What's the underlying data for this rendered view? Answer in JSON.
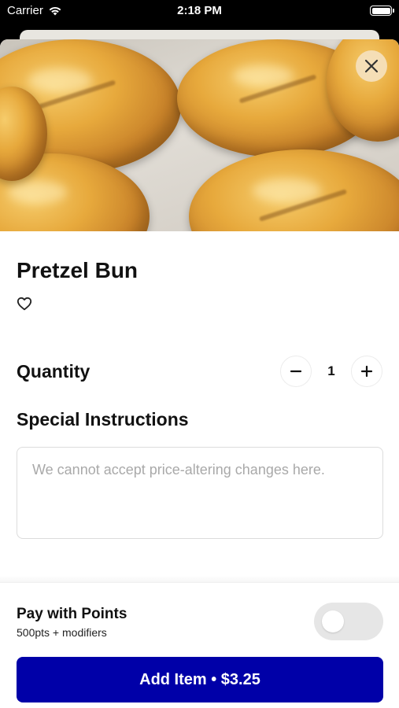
{
  "status_bar": {
    "carrier": "Carrier",
    "time": "2:18 PM",
    "icons": [
      "wifi-icon",
      "battery-icon"
    ]
  },
  "item": {
    "name": "Pretzel Bun",
    "image_alt": "pretzel-bun-photo"
  },
  "quantity": {
    "label": "Quantity",
    "value": "1"
  },
  "instructions": {
    "label": "Special Instructions",
    "placeholder": "We cannot accept price-altering changes here.",
    "value": ""
  },
  "points": {
    "title": "Pay with Points",
    "subtitle": "500pts + modifiers",
    "enabled": false
  },
  "add_button": {
    "label": "Add Item • $3.25"
  },
  "colors": {
    "primary": "#0000a8",
    "close_button_bg": "#f5e1be",
    "toggle_off": "#e6e6e6"
  }
}
